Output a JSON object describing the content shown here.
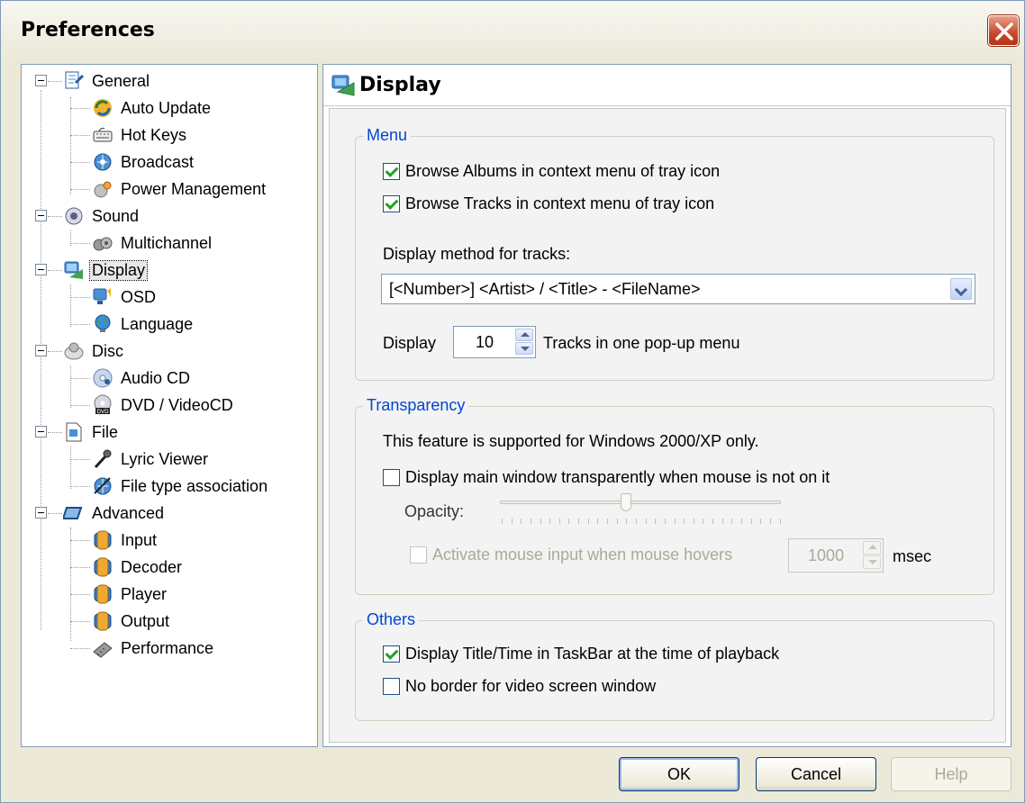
{
  "window": {
    "title": "Preferences"
  },
  "tree": {
    "items": [
      {
        "label": "General",
        "icon": "general-icon",
        "level": 0,
        "expanded": true
      },
      {
        "label": "Auto Update",
        "icon": "auto-update-icon",
        "level": 1
      },
      {
        "label": "Hot Keys",
        "icon": "keyboard-icon",
        "level": 1
      },
      {
        "label": "Broadcast",
        "icon": "broadcast-icon",
        "level": 1
      },
      {
        "label": "Power Management",
        "icon": "power-icon",
        "level": 1
      },
      {
        "label": "Sound",
        "icon": "speaker-icon",
        "level": 0,
        "expanded": true
      },
      {
        "label": "Multichannel",
        "icon": "multichannel-icon",
        "level": 1
      },
      {
        "label": "Display",
        "icon": "display-icon",
        "level": 0,
        "expanded": true,
        "selected": true
      },
      {
        "label": "OSD",
        "icon": "osd-icon",
        "level": 1
      },
      {
        "label": "Language",
        "icon": "globe-icon",
        "level": 1
      },
      {
        "label": "Disc",
        "icon": "disc-icon",
        "level": 0,
        "expanded": true
      },
      {
        "label": "Audio CD",
        "icon": "audio-cd-icon",
        "level": 1
      },
      {
        "label": "DVD / VideoCD",
        "icon": "dvd-icon",
        "level": 1
      },
      {
        "label": "File",
        "icon": "file-icon",
        "level": 0,
        "expanded": true
      },
      {
        "label": "Lyric Viewer",
        "icon": "microphone-icon",
        "level": 1
      },
      {
        "label": "File type association",
        "icon": "file-association-icon",
        "level": 1
      },
      {
        "label": "Advanced",
        "icon": "advanced-icon",
        "level": 0,
        "expanded": true
      },
      {
        "label": "Input",
        "icon": "plugin-icon",
        "level": 1
      },
      {
        "label": "Decoder",
        "icon": "plugin-icon",
        "level": 1
      },
      {
        "label": "Player",
        "icon": "plugin-icon",
        "level": 1
      },
      {
        "label": "Output",
        "icon": "plugin-icon",
        "level": 1
      },
      {
        "label": "Performance",
        "icon": "chip-icon",
        "level": 1
      }
    ]
  },
  "panel": {
    "title": "Display",
    "menu": {
      "legend": "Menu",
      "browse_albums": {
        "label": "Browse Albums in context menu of tray icon",
        "checked": true
      },
      "browse_tracks": {
        "label": "Browse Tracks in context menu of tray icon",
        "checked": true
      },
      "display_method_label": "Display method for tracks:",
      "display_method_value": "[<Number>] <Artist> / <Title> - <FileName>",
      "display_prefix": "Display",
      "tracks_count": "10",
      "tracks_suffix": "Tracks in one pop-up menu"
    },
    "transparency": {
      "legend": "Transparency",
      "note": "This feature is supported for Windows 2000/XP only.",
      "transparent_option": {
        "label": "Display main window transparently when mouse is not on it",
        "checked": false
      },
      "opacity_label": "Opacity:",
      "opacity_level": 0.45,
      "activate_option": {
        "label": "Activate mouse input when mouse hovers",
        "checked": false,
        "disabled": true
      },
      "hover_ms": "1000",
      "hover_unit": "msec"
    },
    "others": {
      "legend": "Others",
      "taskbar_option": {
        "label": "Display Title/Time in TaskBar at the time of playback",
        "checked": true
      },
      "no_border_option": {
        "label": "No border for video screen window",
        "checked": false
      }
    }
  },
  "buttons": {
    "ok": "OK",
    "cancel": "Cancel",
    "help": "Help"
  },
  "colors": {
    "accent": "#0046d5",
    "close": "#c8482a",
    "check": "#21a121"
  }
}
